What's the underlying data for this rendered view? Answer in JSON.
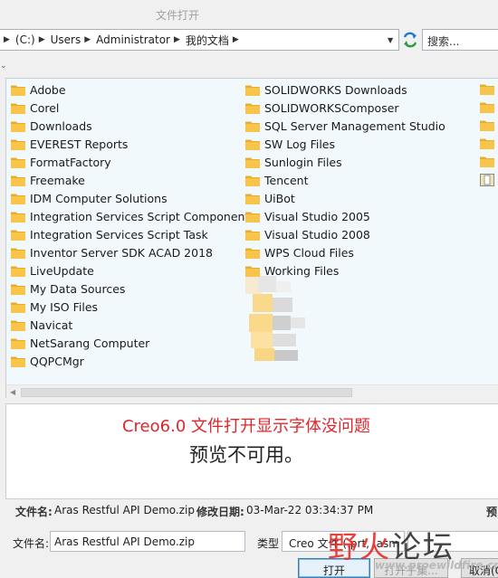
{
  "window": {
    "title": "文件打开"
  },
  "address": {
    "crumbs": [
      "(C:)",
      "Users",
      "Administrator",
      "我的文档"
    ],
    "search_placeholder": "搜索..."
  },
  "files": {
    "column1": [
      "Adobe",
      "Corel",
      "Downloads",
      "EVEREST Reports",
      "FormatFactory",
      "Freemake",
      "IDM Computer Solutions",
      "Integration Services Script Component",
      "Integration Services Script Task",
      "Inventor Server SDK ACAD 2018",
      "LiveUpdate",
      "My Data Sources",
      "My ISO Files",
      "Navicat",
      "NetSarang Computer",
      "QQPCMgr"
    ],
    "column2": [
      "SOLIDWORKS Downloads",
      "SOLIDWORKSComposer",
      "SQL Server Management Studio",
      "SW Log Files",
      "Sunlogin Files",
      "Tencent",
      "UiBot",
      "Visual Studio 2005",
      "Visual Studio 2008",
      "WPS Cloud Files",
      "Working Files"
    ]
  },
  "preview": {
    "annotation": "Creo6.0 文件打开显示字体没问题",
    "message": "预览不可用。"
  },
  "details": {
    "name_label": "文件名:",
    "name_value": "Aras Restful API Demo.zip",
    "modified_label": "修改日期:",
    "modified_value": "03-Mar-22 03:34:37 PM",
    "extra": "预"
  },
  "filename_row": {
    "label": "文件名:",
    "value": "Aras Restful API Demo.zip",
    "type_label": "类型",
    "type_value": "Creo 文件 (.prt, .asm"
  },
  "buttons": {
    "open": "打开",
    "open_in": "打开子集...",
    "cancel": "取消(C"
  },
  "watermark": {
    "text_red": "野火",
    "text_dark": "论坛",
    "url": "www.proewildfire.cn"
  },
  "colors": {
    "folder": "#f8c44a",
    "annotation": "#e0262b",
    "selection_bg": "#f2f9fd"
  }
}
